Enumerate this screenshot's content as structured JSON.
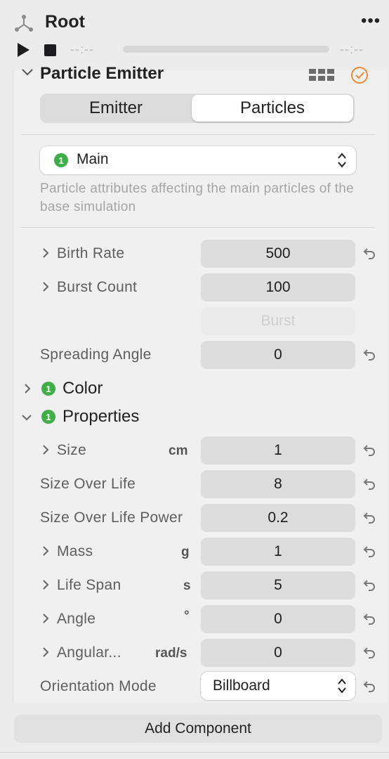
{
  "header": {
    "title": "Root",
    "more_label": "•••",
    "time_start": "--:--",
    "time_end": "--:--"
  },
  "component": {
    "title": "Particle Emitter",
    "tabs": [
      {
        "label": "Emitter",
        "selected": false
      },
      {
        "label": "Particles",
        "selected": true
      }
    ],
    "layer_select": {
      "badge": "1",
      "value": "Main"
    },
    "description": "Particle attributes affecting the main particles of the base simulation"
  },
  "rows_top": [
    {
      "label": "Birth Rate",
      "value": "500",
      "expandable": true,
      "resettable": true
    },
    {
      "label": "Burst Count",
      "value": "100",
      "expandable": true,
      "resettable": false
    },
    {
      "label": "Spreading Angle",
      "value": "0",
      "expandable": false,
      "resettable": true
    }
  ],
  "burst_button": "Burst",
  "sections": [
    {
      "title": "Color",
      "badge": "1",
      "expanded": false
    },
    {
      "title": "Properties",
      "badge": "1",
      "expanded": true
    }
  ],
  "properties": [
    {
      "label": "Size",
      "unit": "cm",
      "value": "1",
      "expandable": true
    },
    {
      "label": "Size Over Life",
      "unit": "",
      "value": "8",
      "expandable": false
    },
    {
      "label": "Size Over Life Power",
      "unit": "",
      "value": "0.2",
      "expandable": false
    },
    {
      "label": "Mass",
      "unit": "g",
      "value": "1",
      "expandable": true
    },
    {
      "label": "Life Span",
      "unit": "s",
      "value": "5",
      "expandable": true
    },
    {
      "label": "Angle",
      "unit": "°",
      "value": "0",
      "expandable": true
    },
    {
      "label": "Angular...",
      "unit": "rad/s",
      "value": "0",
      "expandable": true
    }
  ],
  "orientation": {
    "label": "Orientation Mode",
    "value": "Billboard"
  },
  "add_component_label": "Add Component",
  "colors": {
    "badge_green": "#3fae49",
    "check_orange": "#ef8a3a",
    "field_bg": "#dcdcdc",
    "label_gray": "#5e5e5e"
  }
}
